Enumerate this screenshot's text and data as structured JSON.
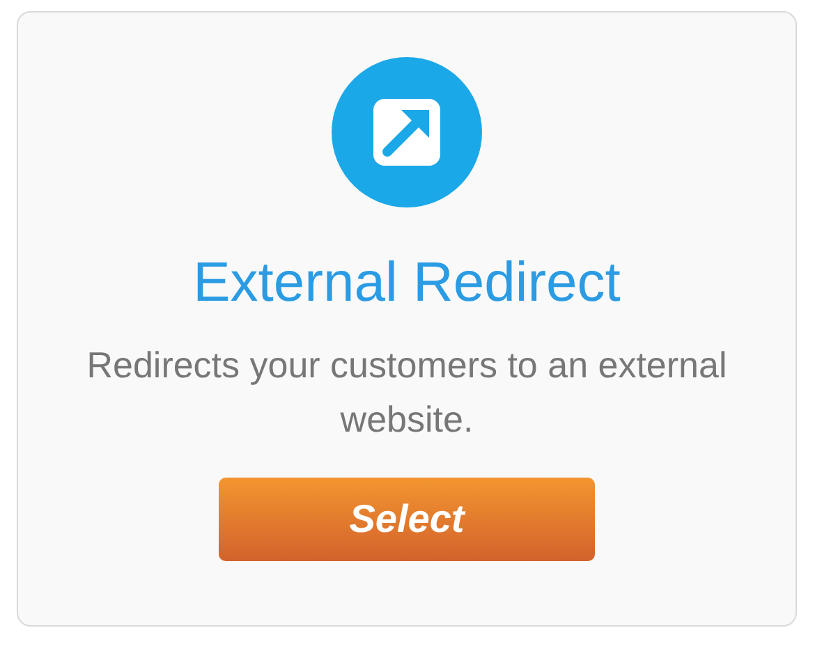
{
  "card": {
    "title": "External Redirect",
    "description": "Redirects your customers to an external website.",
    "button": "Select"
  }
}
